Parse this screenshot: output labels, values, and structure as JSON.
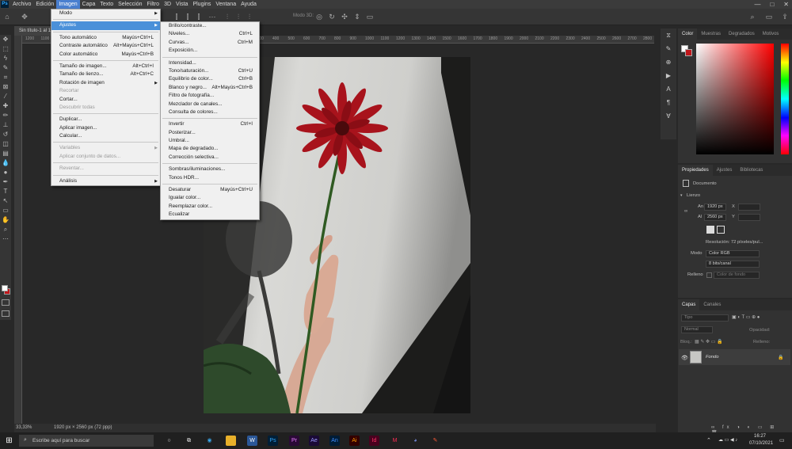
{
  "app": {
    "logo": "Ps"
  },
  "menubar": {
    "items": [
      "Archivo",
      "Edición",
      "Imagen",
      "Capa",
      "Texto",
      "Selección",
      "Filtro",
      "3D",
      "Vista",
      "Plugins",
      "Ventana",
      "Ayuda"
    ],
    "active": "Imagen"
  },
  "window_controls": [
    "—",
    "□",
    "✕"
  ],
  "options_bar": {
    "mode_3d": "Modo 3D:"
  },
  "document": {
    "tab_title": "Sin título-1 al 1",
    "zoom": "33,33%",
    "size_info": "1920 px × 2560 px (72 ppp)",
    "ruler_marks": [
      "1200",
      "1100",
      "1000",
      "900",
      "800",
      "700",
      "600",
      "500",
      "400",
      "300",
      "200",
      "100",
      "0",
      "100",
      "200",
      "300",
      "400",
      "500",
      "600",
      "700",
      "800",
      "900",
      "1000",
      "1100",
      "1200",
      "1300",
      "1400",
      "1500",
      "1600",
      "1700",
      "1800",
      "1900",
      "2000",
      "2100",
      "2200",
      "2300",
      "2400",
      "2500",
      "2600",
      "2700",
      "2800"
    ]
  },
  "imagen_menu": [
    {
      "label": "Modo",
      "arrow": "▶"
    },
    {
      "sep": true
    },
    {
      "label": "Ajustes",
      "arrow": "▶",
      "highlight": true
    },
    {
      "sep": true
    },
    {
      "label": "Tono automático",
      "shortcut": "Mayús+Ctrl+L"
    },
    {
      "label": "Contraste automático",
      "shortcut": "Alt+Mayús+Ctrl+L"
    },
    {
      "label": "Color automático",
      "shortcut": "Mayús+Ctrl+B"
    },
    {
      "sep": true
    },
    {
      "label": "Tamaño de imagen...",
      "shortcut": "Alt+Ctrl+I"
    },
    {
      "label": "Tamaño de lienzo...",
      "shortcut": "Alt+Ctrl+C"
    },
    {
      "label": "Rotación de imagen",
      "arrow": "▶"
    },
    {
      "label": "Recortar",
      "disabled": true
    },
    {
      "label": "Cortar..."
    },
    {
      "label": "Descubrir todas",
      "disabled": true
    },
    {
      "sep": true
    },
    {
      "label": "Duplicar..."
    },
    {
      "label": "Aplicar imagen..."
    },
    {
      "label": "Calcular..."
    },
    {
      "sep": true
    },
    {
      "label": "Variables",
      "arrow": "▶",
      "disabled": true
    },
    {
      "label": "Aplicar conjunto de datos...",
      "disabled": true
    },
    {
      "sep": true
    },
    {
      "label": "Reventar...",
      "disabled": true
    },
    {
      "sep": true
    },
    {
      "label": "Análisis",
      "arrow": "▶"
    }
  ],
  "ajustes_menu": [
    {
      "label": "Brillo/contraste..."
    },
    {
      "label": "Niveles...",
      "shortcut": "Ctrl+L"
    },
    {
      "label": "Curvas...",
      "shortcut": "Ctrl+M"
    },
    {
      "label": "Exposición..."
    },
    {
      "sep": true
    },
    {
      "label": "Intensidad..."
    },
    {
      "label": "Tono/saturación...",
      "shortcut": "Ctrl+U"
    },
    {
      "label": "Equilibrio de color...",
      "shortcut": "Ctrl+B"
    },
    {
      "label": "Blanco y negro...",
      "shortcut": "Alt+Mayús+Ctrl+B"
    },
    {
      "label": "Filtro de fotografía..."
    },
    {
      "label": "Mezclador de canales..."
    },
    {
      "label": "Consulta de colores..."
    },
    {
      "sep": true
    },
    {
      "label": "Invertir",
      "shortcut": "Ctrl+I"
    },
    {
      "label": "Posterizar..."
    },
    {
      "label": "Umbral..."
    },
    {
      "label": "Mapa de degradado..."
    },
    {
      "label": "Corrección selectiva..."
    },
    {
      "sep": true
    },
    {
      "label": "Sombras/iluminaciones..."
    },
    {
      "label": "Tonos HDR..."
    },
    {
      "sep": true
    },
    {
      "label": "Desaturar",
      "shortcut": "Mayús+Ctrl+U"
    },
    {
      "label": "Igualar color..."
    },
    {
      "label": "Reemplazar color..."
    },
    {
      "label": "Ecualizar"
    }
  ],
  "color_panel": {
    "tabs": [
      "Color",
      "Muestras",
      "Degradados",
      "Motivos"
    ]
  },
  "properties_panel": {
    "tabs": [
      "Propiedades",
      "Ajustes",
      "Bibliotecas"
    ],
    "doc_label": "Documento",
    "section": "Lienzo",
    "w_label": "An",
    "w_value": "1920 px",
    "h_label": "Al",
    "h_value": "2560 px",
    "x_label": "X",
    "y_label": "Y",
    "resolution": "Resolución: 72 píxeles/pul...",
    "mode_label": "Modo",
    "mode_value": "Color RGB",
    "depth_value": "8 bits/canal",
    "fill_label": "Relleno",
    "fill_value": "Color de fondo"
  },
  "layers_panel": {
    "tabs": [
      "Capas",
      "Canales"
    ],
    "search_placeholder": "Tipo",
    "blend": "Normal",
    "opacity_label": "Opacidad:",
    "lock_label": "Bloq.:",
    "fill_label": "Relleno:",
    "layer_name": "Fondo"
  },
  "taskbar": {
    "search_placeholder": "Escribe aquí para buscar",
    "time": "16:27",
    "date": "07/10/2021",
    "apps": [
      "Ps",
      "Pr",
      "Ae",
      "An",
      "Ai",
      "Id"
    ]
  }
}
